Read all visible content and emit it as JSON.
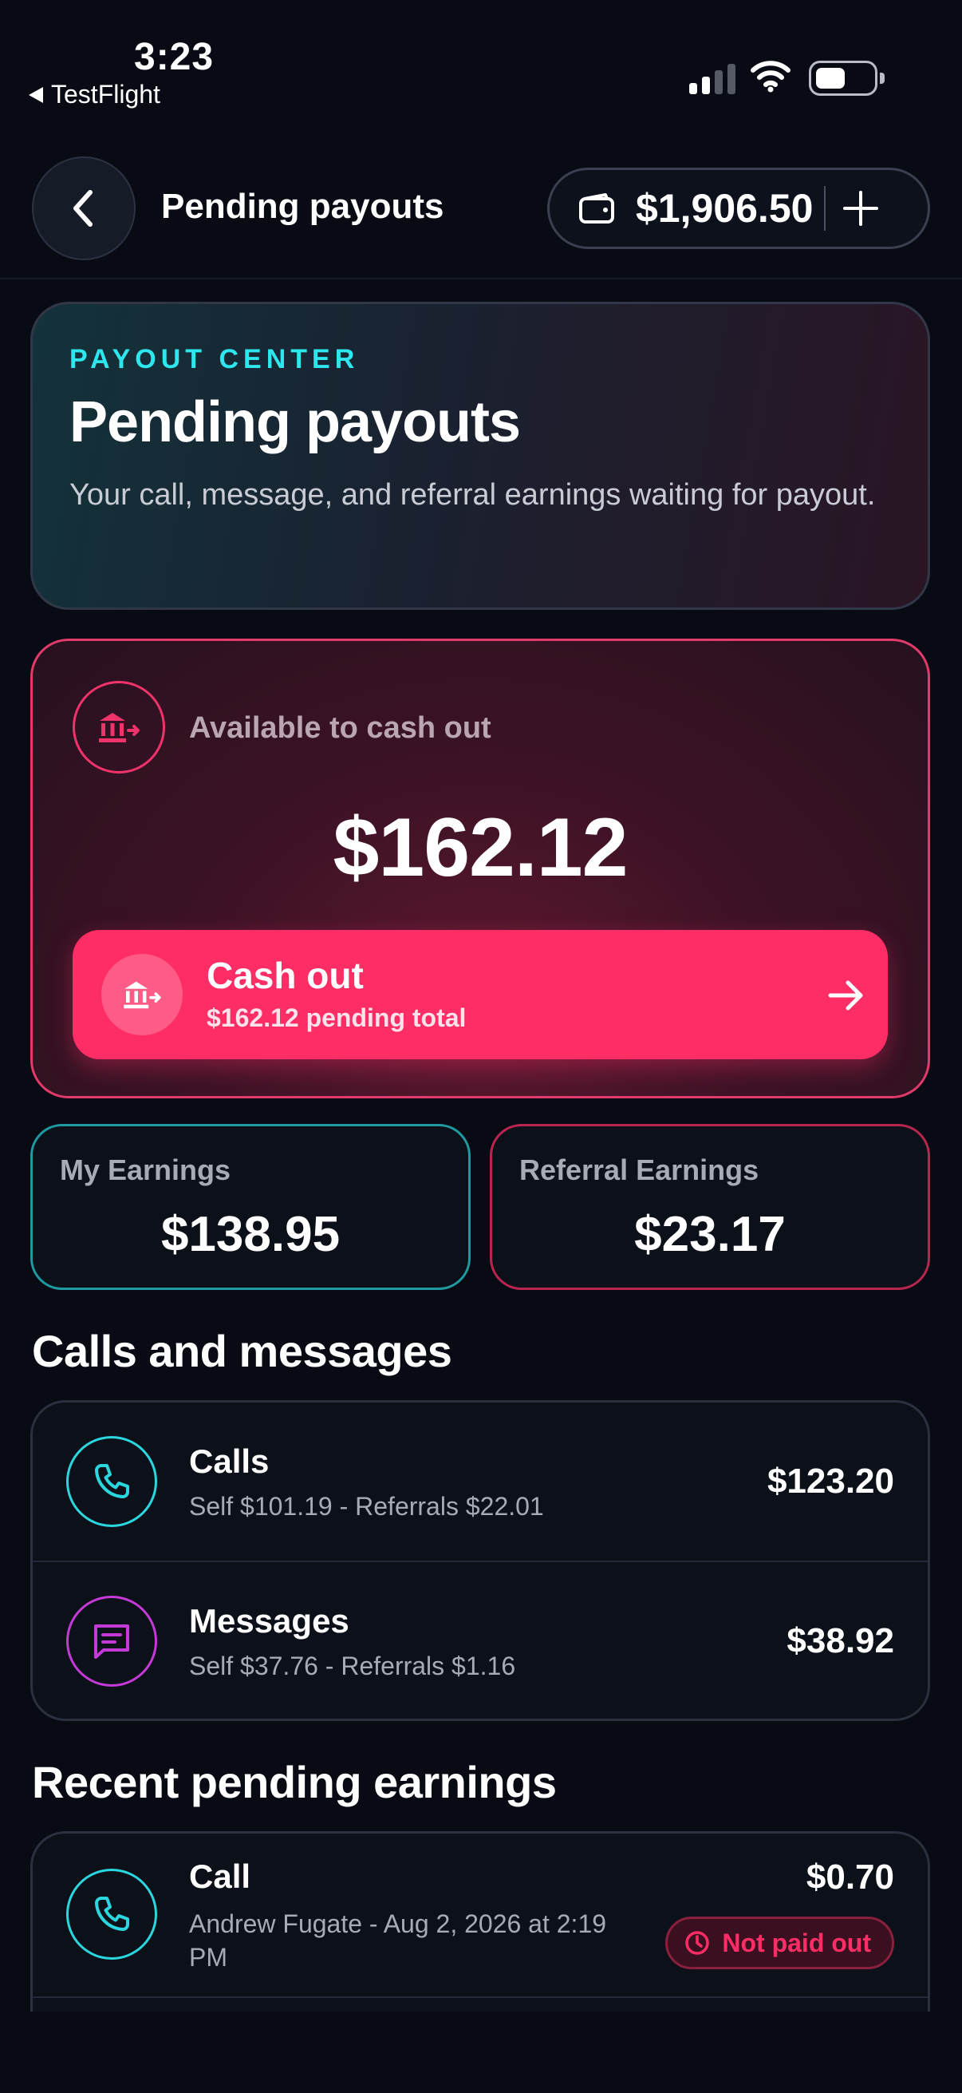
{
  "status_bar": {
    "time": "3:23",
    "back_app": "TestFlight"
  },
  "header": {
    "title": "Pending payouts",
    "wallet_balance": "$1,906.50"
  },
  "hero": {
    "kicker": "PAYOUT CENTER",
    "title": "Pending payouts",
    "description": "Your call, message, and referral earnings waiting for payout."
  },
  "available": {
    "label": "Available to cash out",
    "amount": "$162.12",
    "cashout_title": "Cash out",
    "cashout_subtitle": "$162.12 pending total"
  },
  "stats": {
    "my_earnings_label": "My Earnings",
    "my_earnings_value": "$138.95",
    "referral_label": "Referral Earnings",
    "referral_value": "$23.17"
  },
  "calls_messages": {
    "heading": "Calls and messages",
    "items": [
      {
        "title": "Calls",
        "subtitle": "Self $101.19 - Referrals $22.01",
        "amount": "$123.20",
        "icon": "phone-icon"
      },
      {
        "title": "Messages",
        "subtitle": "Self $37.76 - Referrals $1.16",
        "amount": "$38.92",
        "icon": "message-icon"
      }
    ]
  },
  "recent": {
    "heading": "Recent pending earnings",
    "items": [
      {
        "title": "Call",
        "subtitle": "Andrew Fugate - Aug 2, 2026 at 2:19 PM",
        "amount": "$0.70",
        "status": "Not paid out",
        "icon": "phone-icon"
      }
    ]
  },
  "colors": {
    "accent_cyan": "#2ee6ee",
    "accent_pink": "#ff2d66",
    "accent_purple": "#c43ad6",
    "background": "#080b14"
  }
}
